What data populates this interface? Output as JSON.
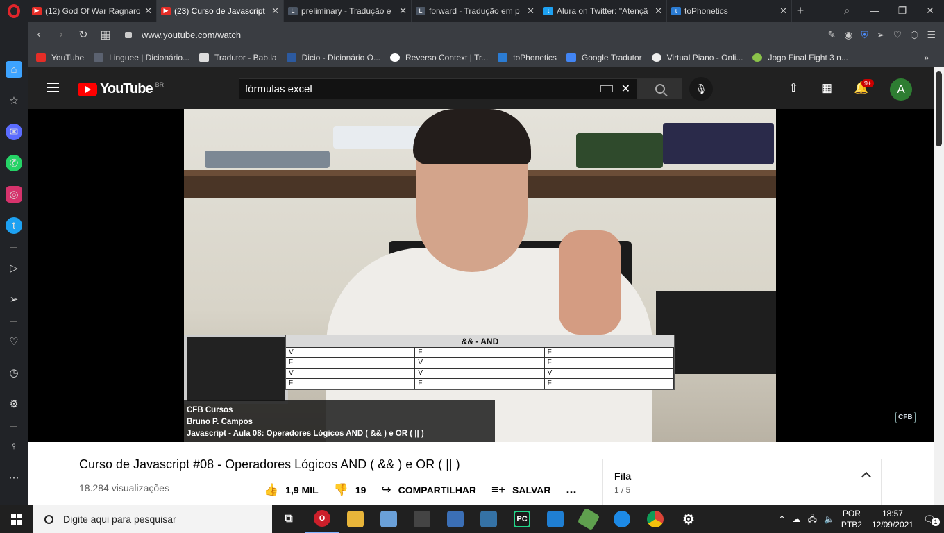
{
  "browser": {
    "tabs": [
      {
        "title": "(12) God Of War Ragnaro",
        "favicon_color": "#e52d27",
        "active": false
      },
      {
        "title": "(23) Curso de Javascript",
        "favicon_color": "#e52d27",
        "active": true
      },
      {
        "title": "preliminary - Tradução e",
        "favicon_color": "#4b5563",
        "active": false
      },
      {
        "title": "forward - Tradução em p",
        "favicon_color": "#4b5563",
        "active": false
      },
      {
        "title": "Alura on Twitter: \"Atençã",
        "favicon_color": "#1da1f2",
        "active": false
      },
      {
        "title": "toPhonetics",
        "favicon_color": "#2b7cd3",
        "active": false
      }
    ],
    "url": "www.youtube.com/watch",
    "bookmarks": [
      {
        "label": "YouTube",
        "color": "#e52d27"
      },
      {
        "label": "Linguee | Dicionário...",
        "color": "#5b6270"
      },
      {
        "label": "Tradutor - Bab.la",
        "color": "#ddd"
      },
      {
        "label": "Dicio - Dicionário O...",
        "color": "#2c5aa0"
      },
      {
        "label": "Reverso Context | Tr...",
        "color": "#ffffff"
      },
      {
        "label": "toPhonetics",
        "color": "#2b7cd3"
      },
      {
        "label": "Google Tradutor",
        "color": "#4285f4"
      },
      {
        "label": "Virtual Piano - Onli...",
        "color": "#eee"
      },
      {
        "label": "Jogo Final Fight 3 n...",
        "color": "#8bc34a"
      }
    ],
    "bookmarks_more": "»"
  },
  "sidebar": {
    "icons": [
      "home-icon",
      "bookmark-icon",
      "messenger-icon",
      "whatsapp-icon",
      "instagram-icon",
      "twitter-icon",
      "player-icon",
      "send-icon",
      "heart-icon",
      "history-icon",
      "settings-icon",
      "bulb-icon",
      "more-icon"
    ]
  },
  "youtube": {
    "logo_text": "YouTube",
    "country_code": "BR",
    "search_value": "fórmulas excel",
    "notifications_badge": "9+",
    "avatar_letter": "A",
    "video": {
      "table_title": "&& - AND",
      "table_rows": [
        [
          "V",
          "F",
          "F"
        ],
        [
          "F",
          "V",
          "F"
        ],
        [
          "V",
          "V",
          "V"
        ],
        [
          "F",
          "F",
          "F"
        ]
      ],
      "caption_lines": [
        "CFB Cursos",
        "Bruno P. Campos",
        "Javascript - Aula 08: Operadores Lógicos AND ( && ) e OR ( || )"
      ],
      "watermark": "CFB"
    },
    "title": "Curso de Javascript #08 - Operadores Lógicos AND ( && ) e OR ( || )",
    "views": "18.284 visualizações",
    "likes": "1,9 MIL",
    "dislikes": "19",
    "share_label": "COMPARTILHAR",
    "save_label": "SALVAR",
    "more_label": "...",
    "queue": {
      "title": "Fila",
      "count": "1 / 5"
    }
  },
  "taskbar": {
    "search_placeholder": "Digite aqui para pesquisar",
    "apps": [
      {
        "name": "task-view",
        "color": "transparent",
        "glyph": "⧉"
      },
      {
        "name": "opera",
        "color": "#cc1f2a",
        "glyph": "O"
      },
      {
        "name": "file-explorer",
        "color": "#e8b53a",
        "glyph": ""
      },
      {
        "name": "paint",
        "color": "#6aa0d8",
        "glyph": ""
      },
      {
        "name": "unknown-app",
        "color": "#444",
        "glyph": ""
      },
      {
        "name": "network-app",
        "color": "#3b6fb6",
        "glyph": ""
      },
      {
        "name": "python-app",
        "color": "#3572a5",
        "glyph": ""
      },
      {
        "name": "pycharm",
        "color": "#1b1b1b",
        "glyph": "PC"
      },
      {
        "name": "vscode",
        "color": "#1f7fd3",
        "glyph": ""
      },
      {
        "name": "nodejs",
        "color": "#5fa04e",
        "glyph": ""
      },
      {
        "name": "edge",
        "color": "#1d8ae6",
        "glyph": ""
      },
      {
        "name": "chrome",
        "color": "#e0a32b",
        "glyph": ""
      },
      {
        "name": "settings",
        "color": "transparent",
        "glyph": "⚙"
      }
    ],
    "language": "POR",
    "keyboard": "PTB2",
    "time": "18:57",
    "date": "12/09/2021",
    "notifications": "1"
  }
}
